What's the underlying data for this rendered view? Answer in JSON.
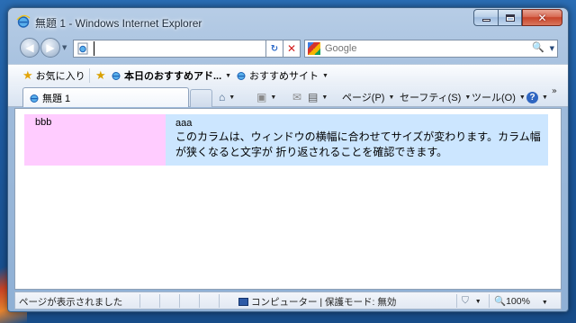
{
  "window": {
    "title": "無題 1 - Windows Internet Explorer",
    "close_glyph": "✕"
  },
  "address_bar": {
    "url_value": "",
    "refresh_glyph": "↻",
    "stop_glyph": "✕"
  },
  "search": {
    "placeholder": "Google",
    "go_glyph": "🔍"
  },
  "favorites_bar": {
    "favorites_label": "お気に入り",
    "items": [
      {
        "label": "本日のおすすめアド..."
      },
      {
        "label": "おすすめサイト"
      }
    ]
  },
  "tab": {
    "label": "無題 1"
  },
  "command_bar": {
    "page_label": "ページ(P)",
    "safety_label": "セーフティ(S)",
    "tools_label": "ツール(O)",
    "help_glyph": "?",
    "chevron": "»"
  },
  "page": {
    "left_column_text": "bbb",
    "right_column_heading": "aaa",
    "right_column_body": "このカラムは、ウィンドウの横幅に合わせてサイズが変わります。カラム幅が狭くなると文字が 折り返されることを確認できます。"
  },
  "status_bar": {
    "status_text": "ページが表示されました",
    "zone_text": "コンピューター | 保護モード: 無効",
    "zoom": "100%"
  }
}
